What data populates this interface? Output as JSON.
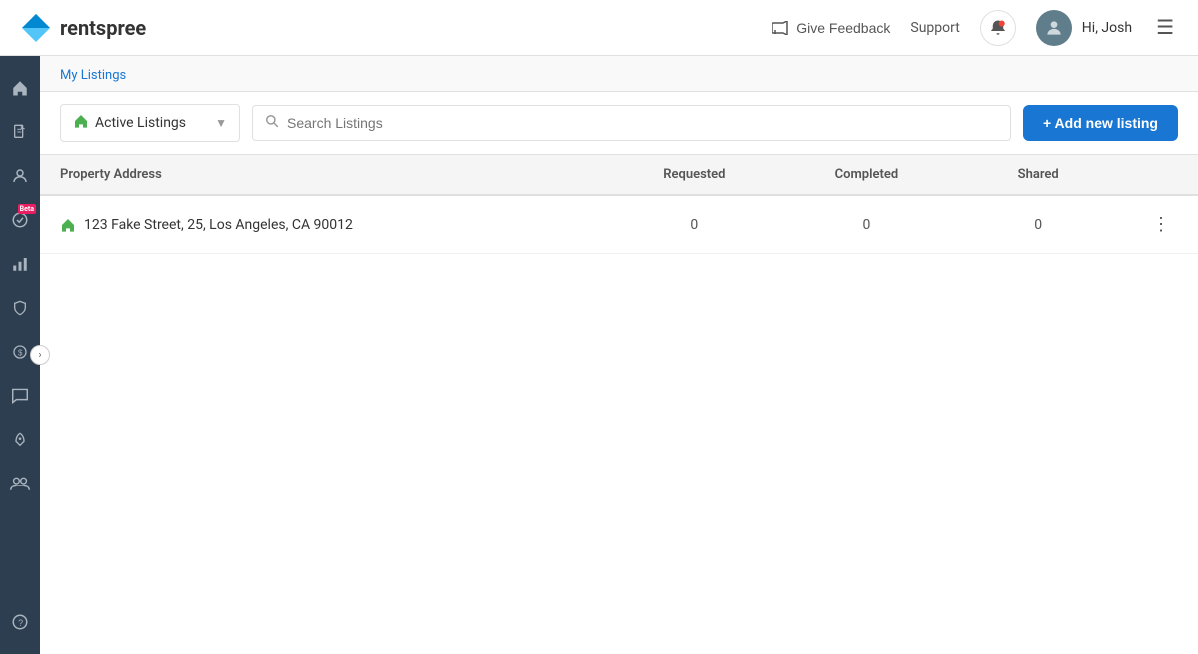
{
  "app": {
    "name_prefix": "rent",
    "name_bold": "spree"
  },
  "topnav": {
    "feedback_label": "Give Feedback",
    "support_label": "Support",
    "hi_user": "Hi, Josh"
  },
  "breadcrumb": {
    "text": "My Listings"
  },
  "toolbar": {
    "filter_label": "Active Listings",
    "search_placeholder": "Search Listings",
    "add_button_label": "+ Add new listing"
  },
  "table": {
    "columns": [
      {
        "key": "address",
        "label": "Property Address"
      },
      {
        "key": "requested",
        "label": "Requested"
      },
      {
        "key": "completed",
        "label": "Completed"
      },
      {
        "key": "shared",
        "label": "Shared"
      }
    ],
    "rows": [
      {
        "address": "123 Fake Street, 25, Los Angeles, CA 90012",
        "requested": "0",
        "completed": "0",
        "shared": "0"
      }
    ]
  },
  "sidebar": {
    "icons": [
      {
        "name": "home-icon",
        "glyph": "⌂"
      },
      {
        "name": "document-icon",
        "glyph": "📄"
      },
      {
        "name": "user-icon",
        "glyph": "👤"
      },
      {
        "name": "verified-icon",
        "glyph": "✓",
        "beta": true
      },
      {
        "name": "report-icon",
        "glyph": "📊"
      },
      {
        "name": "shield-icon",
        "glyph": "🛡"
      },
      {
        "name": "dollar-icon",
        "glyph": "💲"
      },
      {
        "name": "chat-icon",
        "glyph": "💬"
      },
      {
        "name": "rocket-icon",
        "glyph": "🚀"
      },
      {
        "name": "people-icon",
        "glyph": "👥"
      },
      {
        "name": "help-icon",
        "glyph": "?"
      }
    ]
  }
}
